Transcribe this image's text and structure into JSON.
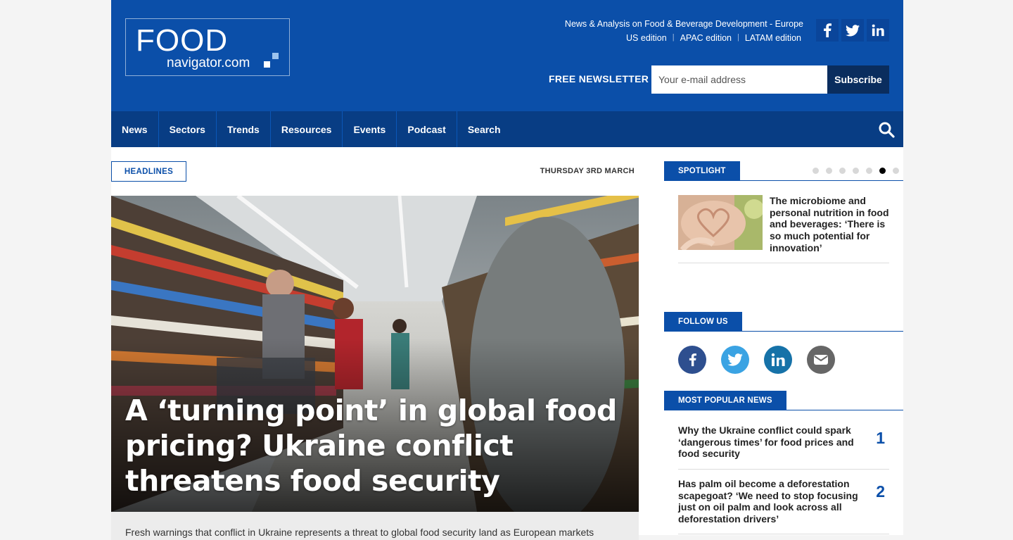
{
  "header": {
    "logo_line1": "FOOD",
    "logo_line2": "navigator.com",
    "tagline": "News & Analysis on Food & Beverage Development - Europe",
    "editions": [
      "US edition",
      "APAC edition",
      "LATAM edition"
    ],
    "social": [
      "f",
      "facebook-icon",
      "twitter-icon",
      "linkedin-icon"
    ],
    "newsletter_label": "FREE NEWSLETTER",
    "email_placeholder": "Your e-mail address",
    "subscribe_label": "Subscribe",
    "brand_color": "#0b4fa9",
    "nav_color": "#083d84"
  },
  "nav": {
    "items": [
      "News",
      "Sectors",
      "Trends",
      "Resources",
      "Events",
      "Podcast",
      "Search"
    ]
  },
  "main": {
    "headlines_label": "HEADLINES",
    "date": "THURSDAY 3RD MARCH",
    "hero_title": "A ‘turning point’ in global food pricing? Ukraine conflict threatens food security",
    "excerpt": "Fresh warnings that conflict in Ukraine represents a threat to global food security land as European markets"
  },
  "sidebar": {
    "spotlight_label": "SPOTLIGHT",
    "spotlight_title": "The microbiome and personal nutrition in food and beverages: ‘There is so much potential for innovation’",
    "follow_label": "FOLLOW US",
    "popular_label": "MOST POPULAR NEWS",
    "popular": [
      {
        "title": "Why the Ukraine conflict could spark ‘dangerous times’ for food prices and food security",
        "rank": "1"
      },
      {
        "title": "Has palm oil become a deforestation scapegoat? ‘We need to stop focusing just on oil palm and look across all deforestation drivers’",
        "rank": "2"
      }
    ]
  }
}
